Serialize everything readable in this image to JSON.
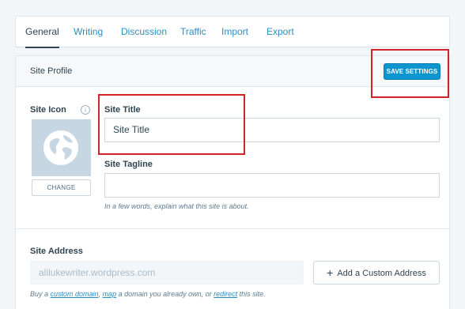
{
  "tabs": [
    "General",
    "Writing",
    "Discussion",
    "Traffic",
    "Import",
    "Export"
  ],
  "header": {
    "title": "Site Profile",
    "save_label": "SAVE SETTINGS"
  },
  "site_icon": {
    "label": "Site Icon",
    "info_glyph": "i",
    "change_label": "CHANGE",
    "icon": "globe-icon"
  },
  "site_title": {
    "label": "Site Title",
    "value": "Site Title"
  },
  "site_tagline": {
    "label": "Site Tagline",
    "value": "",
    "hint": "In a few words, explain what this site is about."
  },
  "site_address": {
    "label": "Site Address",
    "value": "alilukewriter.wordpress.com",
    "custom_button_label": "Add a Custom Address",
    "hint_parts": [
      "Buy a ",
      "custom domain",
      ", ",
      "map",
      " a domain you already own, or ",
      "redirect",
      " this site."
    ]
  },
  "colors": {
    "accent": "#0d95cf",
    "link": "#2d8ec3",
    "highlight": "#d2232a"
  }
}
